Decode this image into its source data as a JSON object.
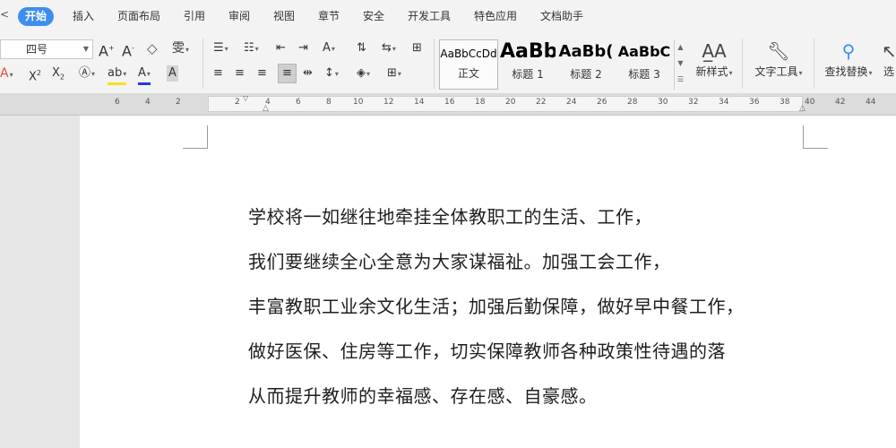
{
  "menubar": {
    "tabs": [
      "开始",
      "插入",
      "页面布局",
      "引用",
      "审阅",
      "视图",
      "章节",
      "安全",
      "开发工具",
      "特色应用",
      "文档助手"
    ],
    "active_tab": "开始"
  },
  "ribbon": {
    "font_size": "四号",
    "styles": [
      {
        "sample": "AaBbCcDd",
        "name": "正文"
      },
      {
        "sample": "AaBb",
        "name": "标题 1"
      },
      {
        "sample": "AaBb(",
        "name": "标题 2"
      },
      {
        "sample": "AaBbC",
        "name": "标题 3"
      }
    ],
    "new_style_label": "新样式",
    "text_tools_label": "文字工具",
    "find_replace_label": "查找替换",
    "select_label": "选"
  },
  "ruler": {
    "numbers": [
      "6",
      "4",
      "2",
      "2",
      "4",
      "6",
      "8",
      "10",
      "12",
      "14",
      "16",
      "18",
      "20",
      "22",
      "24",
      "26",
      "28",
      "30",
      "32",
      "34",
      "36",
      "38",
      "40",
      "42",
      "44"
    ]
  },
  "document": {
    "lines": [
      "学校将一如继往地牵挂全体教职工的生活、工作，",
      "我们要继续全心全意为大家谋福祉。加强工会工作，",
      "丰富教职工业余文化生活；加强后勤保障，做好早中餐工作，",
      "做好医保、住房等工作，切实保障教师各种政策性待遇的落",
      "从而提升教师的幸福感、存在感、自豪感。"
    ]
  },
  "colors": {
    "accent": "#3e8ef0",
    "font_color_underline": "#1a3fd8",
    "highlight_underline": "#f7e21b",
    "clear_icon": "#e84b3c"
  }
}
